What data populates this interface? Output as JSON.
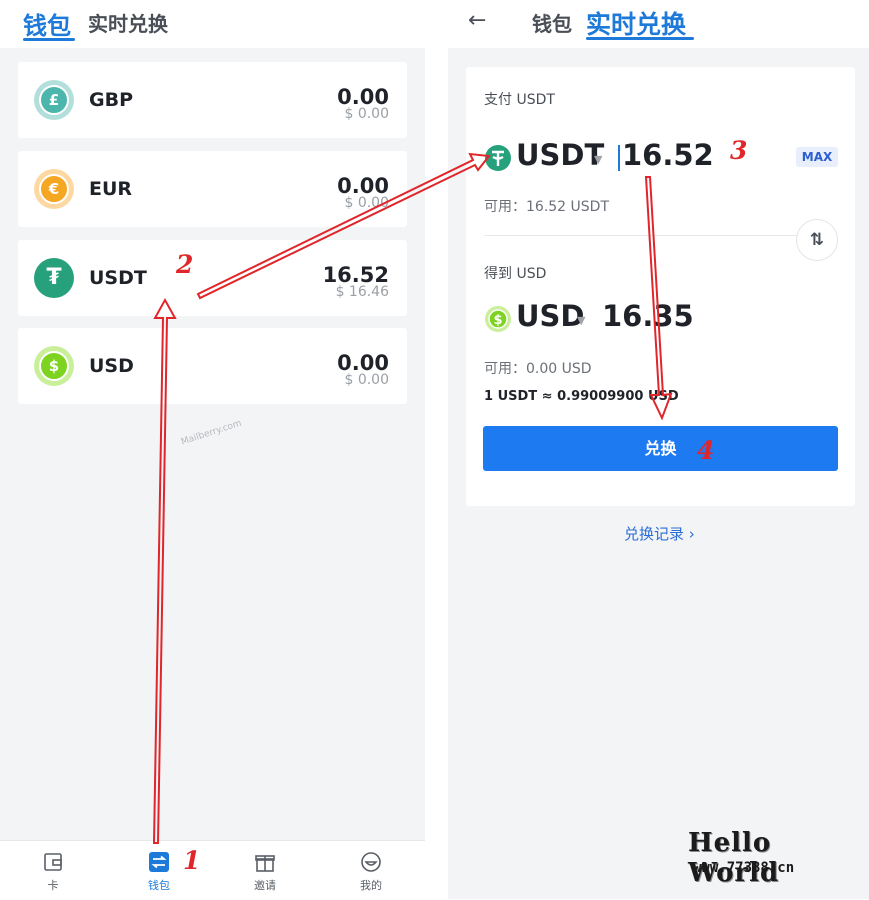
{
  "left": {
    "tabs": {
      "active": "钱包",
      "inactive": "实时兑换"
    },
    "wallets": [
      {
        "code": "GBP",
        "symbol": "£",
        "amount": "0.00",
        "value": "$ 0.00",
        "color": "#4db6ac",
        "ring": "#b2dfdb"
      },
      {
        "code": "EUR",
        "symbol": "€",
        "amount": "0.00",
        "value": "$ 0.00",
        "color": "#f5a623",
        "ring": "#fdd9a1"
      },
      {
        "code": "USDT",
        "symbol": "₮",
        "amount": "16.52",
        "value": "$ 16.46",
        "color": "#26a17b",
        "ring": "#26a17b"
      },
      {
        "code": "USD",
        "symbol": "$",
        "amount": "0.00",
        "value": "$ 0.00",
        "color": "#7ed321",
        "ring": "#c9ef9a"
      }
    ],
    "watermark": "Mailberry.com",
    "nav": [
      {
        "label": "卡",
        "icon": "card-icon"
      },
      {
        "label": "钱包",
        "icon": "wallet-exchange-icon",
        "active": true
      },
      {
        "label": "邀请",
        "icon": "gift-icon"
      },
      {
        "label": "我的",
        "icon": "profile-icon"
      }
    ]
  },
  "right": {
    "back": "←",
    "tabs": {
      "inactive": "钱包",
      "active": "实时兑换"
    },
    "pay": {
      "label": "支付 USDT",
      "currency": "USDT",
      "amount": "16.52",
      "max": "MAX",
      "available": "可用：16.52 USDT"
    },
    "receive": {
      "label": "得到 USD",
      "currency": "USD",
      "amount": "16.35",
      "available": "可用：0.00 USD"
    },
    "rate": "1 USDT ≈ 0.99009900 USD",
    "button": "兑换",
    "history": "兑换记录 ›"
  },
  "annotations": [
    "1",
    "2",
    "3",
    "4"
  ],
  "overlay": {
    "title": "Hello World",
    "url": "www.77388.cn"
  },
  "colors": {
    "accent": "#1e7ad9",
    "button": "#1e7af0",
    "arrow": "#e0262a"
  }
}
